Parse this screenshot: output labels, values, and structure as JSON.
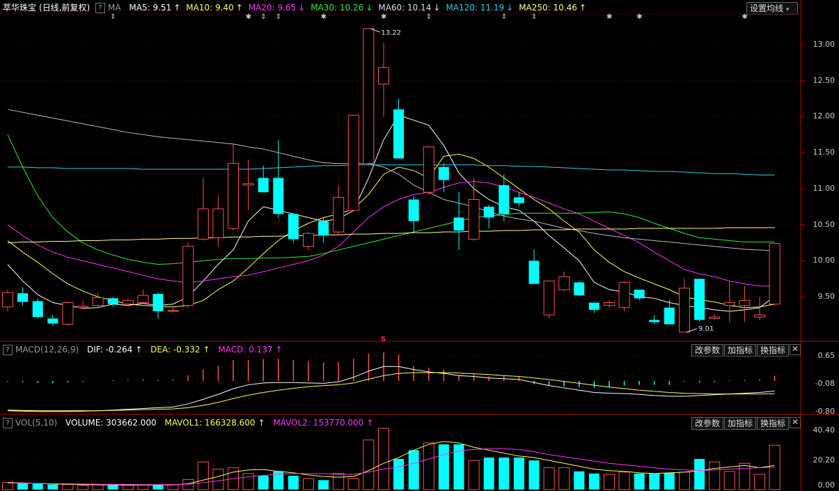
{
  "title": "萃华珠宝",
  "period": "(日线,前复权)",
  "help_label": "?",
  "ma_label": "MA",
  "ma_items": [
    {
      "label": "MA5: 9.51",
      "arrow": "↑",
      "color": "#ffffff"
    },
    {
      "label": "MA10: 9.40",
      "arrow": "↑",
      "color": "#ffff55"
    },
    {
      "label": "MA20: 9.65",
      "arrow": "↓",
      "color": "#ff33ff"
    },
    {
      "label": "MA30: 10.26",
      "arrow": "↓",
      "color": "#33ee33"
    },
    {
      "label": "MA60: 10.14",
      "arrow": "↓",
      "color": "#dddddd"
    },
    {
      "label": "MA120: 11.19",
      "arrow": "↓",
      "color": "#33ccee"
    },
    {
      "label": "MA250: 10.46",
      "arrow": "↑",
      "color": "#ffff88"
    }
  ],
  "settings_button": "设置均线",
  "price_axis": [
    "13.00",
    "12.50",
    "12.00",
    "11.50",
    "11.00",
    "10.50",
    "10.00",
    "9.50"
  ],
  "high_label": "13.22",
  "low_label": "9.01",
  "signal_mark": "S",
  "macd": {
    "label": "MACD(12,26,9)",
    "dif": "DIF: -0.264",
    "dea": "DEA: -0.332",
    "macd": "MACD: 0.137",
    "axis": [
      "0.65",
      "-0.08",
      "-0.80"
    ],
    "btn_params": "改参数",
    "btn_add": "加指标",
    "btn_switch": "换指标",
    "btn_close": "✕"
  },
  "vol": {
    "label": "VOL(5,10)",
    "volume": "VOLUME: 303662.000",
    "mavol1": "MAVOL1: 166328.600",
    "mavol2": "MAVOL2: 153770.000",
    "axis": [
      "40.40",
      "20.20",
      "0.00"
    ],
    "btn_params": "改参数",
    "btn_add": "加指标",
    "btn_switch": "换指标",
    "btn_close": "✕"
  },
  "chart_data": {
    "type": "candlestick",
    "candles": [
      {
        "o": 9.36,
        "c": 9.56,
        "h": 9.6,
        "l": 9.3
      },
      {
        "o": 9.55,
        "c": 9.43,
        "h": 9.63,
        "l": 9.38
      },
      {
        "o": 9.44,
        "c": 9.22,
        "h": 9.48,
        "l": 9.2
      },
      {
        "o": 9.2,
        "c": 9.13,
        "h": 9.25,
        "l": 9.1
      },
      {
        "o": 9.12,
        "c": 9.42,
        "h": 9.44,
        "l": 9.1
      },
      {
        "o": 9.35,
        "c": 9.37,
        "h": 9.45,
        "l": 9.33
      },
      {
        "o": 9.38,
        "c": 9.49,
        "h": 9.55,
        "l": 9.35
      },
      {
        "o": 9.48,
        "c": 9.4,
        "h": 9.5,
        "l": 9.36
      },
      {
        "o": 9.4,
        "c": 9.45,
        "h": 9.48,
        "l": 9.37
      },
      {
        "o": 9.42,
        "c": 9.52,
        "h": 9.6,
        "l": 9.4
      },
      {
        "o": 9.54,
        "c": 9.3,
        "h": 9.56,
        "l": 9.2
      },
      {
        "o": 9.3,
        "c": 9.31,
        "h": 9.35,
        "l": 9.28
      },
      {
        "o": 9.38,
        "c": 10.2,
        "h": 10.25,
        "l": 9.35
      },
      {
        "o": 10.3,
        "c": 10.72,
        "h": 11.15,
        "l": 10.28
      },
      {
        "o": 10.32,
        "c": 10.72,
        "h": 10.9,
        "l": 10.2
      },
      {
        "o": 10.45,
        "c": 11.35,
        "h": 11.62,
        "l": 10.42
      },
      {
        "o": 11.05,
        "c": 11.07,
        "h": 11.4,
        "l": 10.7
      },
      {
        "o": 11.15,
        "c": 10.95,
        "h": 11.32,
        "l": 10.95
      },
      {
        "o": 11.15,
        "c": 10.65,
        "h": 11.68,
        "l": 10.6
      },
      {
        "o": 10.65,
        "c": 10.3,
        "h": 10.65,
        "l": 10.25
      },
      {
        "o": 10.2,
        "c": 10.38,
        "h": 10.4,
        "l": 10.15
      },
      {
        "o": 10.55,
        "c": 10.35,
        "h": 10.6,
        "l": 10.25
      },
      {
        "o": 10.4,
        "c": 10.88,
        "h": 11.05,
        "l": 10.35
      },
      {
        "o": 10.7,
        "c": 12.02,
        "h": 12.02,
        "l": 10.68
      },
      {
        "o": 11.35,
        "c": 13.22,
        "h": 13.22,
        "l": 11.32
      },
      {
        "o": 12.45,
        "c": 12.68,
        "h": 13.02,
        "l": 12.0
      },
      {
        "o": 12.1,
        "c": 11.42,
        "h": 12.25,
        "l": 11.42
      },
      {
        "o": 10.85,
        "c": 10.55,
        "h": 10.9,
        "l": 10.4
      },
      {
        "o": 10.95,
        "c": 11.58,
        "h": 11.6,
        "l": 10.92
      },
      {
        "o": 11.3,
        "c": 11.12,
        "h": 11.35,
        "l": 10.95
      },
      {
        "o": 10.6,
        "c": 10.42,
        "h": 10.95,
        "l": 10.15
      },
      {
        "o": 10.3,
        "c": 10.85,
        "h": 11.15,
        "l": 10.28
      },
      {
        "o": 10.75,
        "c": 10.6,
        "h": 10.78,
        "l": 10.45
      },
      {
        "o": 11.05,
        "c": 10.65,
        "h": 11.2,
        "l": 10.55
      },
      {
        "o": 10.88,
        "c": 10.8,
        "h": 10.95,
        "l": 10.76
      },
      {
        "o": 10.0,
        "c": 9.68,
        "h": 10.16,
        "l": 9.68
      },
      {
        "o": 9.25,
        "c": 9.72,
        "h": 9.72,
        "l": 9.2
      },
      {
        "o": 9.6,
        "c": 9.78,
        "h": 9.85,
        "l": 9.58
      },
      {
        "o": 9.7,
        "c": 9.52,
        "h": 9.72,
        "l": 9.52
      },
      {
        "o": 9.42,
        "c": 9.32,
        "h": 9.42,
        "l": 9.28
      },
      {
        "o": 9.38,
        "c": 9.42,
        "h": 9.45,
        "l": 9.35
      },
      {
        "o": 9.35,
        "c": 9.7,
        "h": 9.72,
        "l": 9.3
      },
      {
        "o": 9.6,
        "c": 9.48,
        "h": 9.6,
        "l": 9.45
      },
      {
        "o": 9.18,
        "c": 9.15,
        "h": 9.25,
        "l": 9.12
      },
      {
        "o": 9.35,
        "c": 9.12,
        "h": 9.46,
        "l": 9.12
      },
      {
        "o": 9.01,
        "c": 9.62,
        "h": 9.75,
        "l": 9.01
      },
      {
        "o": 9.75,
        "c": 9.18,
        "h": 9.75,
        "l": 9.16
      },
      {
        "o": 9.2,
        "c": 9.22,
        "h": 9.26,
        "l": 9.18
      },
      {
        "o": 9.38,
        "c": 9.42,
        "h": 9.72,
        "l": 9.15
      },
      {
        "o": 9.38,
        "c": 9.45,
        "h": 9.65,
        "l": 9.15
      },
      {
        "o": 9.22,
        "c": 9.25,
        "h": 9.5,
        "l": 9.18
      },
      {
        "o": 9.4,
        "c": 10.24,
        "h": 10.24,
        "l": 9.38
      }
    ],
    "ma_lines": {
      "MA5": [
        9.95,
        9.72,
        9.53,
        9.42,
        9.38,
        9.34,
        9.35,
        9.4,
        9.38,
        9.41,
        9.38,
        9.4,
        9.5,
        9.72,
        9.95,
        10.15,
        10.55,
        10.75,
        10.7,
        10.65,
        10.6,
        10.55,
        10.58,
        10.7,
        11.15,
        11.68,
        12.02,
        11.95,
        11.88,
        11.6,
        11.22,
        11.0,
        10.85,
        10.75,
        10.7,
        10.55,
        10.35,
        10.18,
        10.0,
        9.7,
        9.6,
        9.57,
        9.5,
        9.48,
        9.42,
        9.38,
        9.35,
        9.32,
        9.3,
        9.32,
        9.35,
        9.51
      ],
      "MA10": [
        10.28,
        10.12,
        9.98,
        9.82,
        9.68,
        9.58,
        9.5,
        9.45,
        9.4,
        9.38,
        9.37,
        9.36,
        9.38,
        9.45,
        9.6,
        9.72,
        9.9,
        10.1,
        10.28,
        10.42,
        10.52,
        10.6,
        10.65,
        10.72,
        10.92,
        11.2,
        11.3,
        11.25,
        11.15,
        11.45,
        11.48,
        11.42,
        11.3,
        11.15,
        11.0,
        10.85,
        10.72,
        10.55,
        10.4,
        10.15,
        9.98,
        9.85,
        9.76,
        9.68,
        9.6,
        9.5,
        9.46,
        9.43,
        9.38,
        9.35,
        9.36,
        9.4
      ],
      "MA20": [
        10.5,
        10.35,
        10.22,
        10.12,
        10.05,
        10.0,
        9.95,
        9.9,
        9.85,
        9.8,
        9.75,
        9.72,
        9.7,
        9.72,
        9.75,
        9.78,
        9.8,
        9.85,
        9.9,
        9.95,
        10.0,
        10.08,
        10.2,
        10.4,
        10.6,
        10.75,
        10.85,
        10.92,
        10.95,
        11.02,
        11.08,
        11.1,
        11.08,
        11.02,
        10.95,
        10.88,
        10.8,
        10.72,
        10.65,
        10.55,
        10.45,
        10.35,
        10.25,
        10.12,
        10.0,
        9.88,
        9.82,
        9.78,
        9.72,
        9.68,
        9.65,
        9.65
      ],
      "MA30": [
        11.75,
        11.3,
        10.9,
        10.6,
        10.4,
        10.25,
        10.15,
        10.08,
        10.02,
        9.98,
        9.95,
        9.96,
        9.98,
        10.0,
        10.02,
        10.03,
        10.03,
        10.04,
        10.04,
        10.05,
        10.06,
        10.1,
        10.15,
        10.2,
        10.25,
        10.3,
        10.35,
        10.4,
        10.45,
        10.5,
        10.55,
        10.6,
        10.62,
        10.64,
        10.66,
        10.66,
        10.66,
        10.66,
        10.66,
        10.67,
        10.68,
        10.65,
        10.6,
        10.52,
        10.45,
        10.38,
        10.32,
        10.3,
        10.28,
        10.26,
        10.26,
        10.26
      ],
      "MA60": [
        12.1,
        12.06,
        12.02,
        11.98,
        11.94,
        11.9,
        11.86,
        11.82,
        11.78,
        11.75,
        11.72,
        11.7,
        11.68,
        11.66,
        11.64,
        11.62,
        11.58,
        11.55,
        11.5,
        11.45,
        11.4,
        11.36,
        11.35,
        11.35,
        11.35,
        11.3,
        11.2,
        11.05,
        10.95,
        10.85,
        10.8,
        10.75,
        10.68,
        10.62,
        10.58,
        10.55,
        10.5,
        10.45,
        10.42,
        10.38,
        10.35,
        10.32,
        10.3,
        10.28,
        10.26,
        10.24,
        10.22,
        10.2,
        10.18,
        10.16,
        10.15,
        10.14
      ],
      "MA120": [
        11.3,
        11.3,
        11.29,
        11.29,
        11.28,
        11.28,
        11.28,
        11.28,
        11.28,
        11.27,
        11.27,
        11.27,
        11.27,
        11.27,
        11.27,
        11.27,
        11.27,
        11.28,
        11.29,
        11.3,
        11.31,
        11.32,
        11.32,
        11.33,
        11.33,
        11.33,
        11.33,
        11.33,
        11.33,
        11.33,
        11.33,
        11.33,
        11.32,
        11.32,
        11.31,
        11.31,
        11.3,
        11.29,
        11.28,
        11.27,
        11.26,
        11.26,
        11.25,
        11.24,
        11.24,
        11.23,
        11.22,
        11.21,
        11.21,
        11.2,
        11.19,
        11.19
      ],
      "MA250": [
        10.25,
        10.26,
        10.26,
        10.27,
        10.27,
        10.28,
        10.28,
        10.29,
        10.29,
        10.3,
        10.3,
        10.31,
        10.31,
        10.32,
        10.32,
        10.33,
        10.33,
        10.34,
        10.34,
        10.35,
        10.35,
        10.36,
        10.36,
        10.37,
        10.37,
        10.38,
        10.38,
        10.39,
        10.39,
        10.4,
        10.4,
        10.41,
        10.41,
        10.42,
        10.42,
        10.43,
        10.43,
        10.43,
        10.44,
        10.44,
        10.44,
        10.44,
        10.45,
        10.45,
        10.45,
        10.45,
        10.45,
        10.45,
        10.46,
        10.46,
        10.46,
        10.46
      ]
    },
    "macd_hist": [
      -0.02,
      -0.03,
      -0.05,
      -0.06,
      -0.04,
      -0.02,
      0.0,
      0.02,
      0.03,
      0.04,
      0.03,
      0.04,
      0.15,
      0.3,
      0.4,
      0.55,
      0.55,
      0.58,
      0.58,
      0.55,
      0.52,
      0.48,
      0.5,
      0.58,
      0.72,
      0.75,
      0.7,
      0.4,
      0.35,
      0.3,
      0.15,
      0.18,
      0.12,
      0.15,
      0.13,
      -0.08,
      -0.12,
      -0.14,
      -0.16,
      -0.18,
      -0.16,
      -0.12,
      -0.1,
      -0.1,
      -0.1,
      -0.02,
      -0.04,
      -0.03,
      0.02,
      0.03,
      0.04,
      0.137
    ],
    "dif": [
      -0.78,
      -0.79,
      -0.8,
      -0.8,
      -0.8,
      -0.79,
      -0.78,
      -0.76,
      -0.74,
      -0.72,
      -0.7,
      -0.68,
      -0.6,
      -0.48,
      -0.35,
      -0.2,
      -0.1,
      -0.05,
      -0.04,
      -0.04,
      -0.05,
      -0.06,
      -0.02,
      0.1,
      0.26,
      0.38,
      0.38,
      0.3,
      0.24,
      0.2,
      0.14,
      0.12,
      0.08,
      0.06,
      0.04,
      -0.04,
      -0.12,
      -0.18,
      -0.24,
      -0.3,
      -0.32,
      -0.33,
      -0.35,
      -0.38,
      -0.4,
      -0.4,
      -0.38,
      -0.36,
      -0.34,
      -0.32,
      -0.3,
      -0.264
    ],
    "dea": [
      -0.76,
      -0.77,
      -0.78,
      -0.78,
      -0.78,
      -0.78,
      -0.78,
      -0.77,
      -0.76,
      -0.75,
      -0.74,
      -0.73,
      -0.7,
      -0.64,
      -0.56,
      -0.46,
      -0.37,
      -0.3,
      -0.24,
      -0.19,
      -0.15,
      -0.12,
      -0.1,
      -0.05,
      0.05,
      0.14,
      0.2,
      0.22,
      0.22,
      0.22,
      0.21,
      0.19,
      0.17,
      0.14,
      0.12,
      0.08,
      0.04,
      -0.01,
      -0.06,
      -0.11,
      -0.16,
      -0.2,
      -0.24,
      -0.27,
      -0.3,
      -0.32,
      -0.33,
      -0.34,
      -0.34,
      -0.34,
      -0.34,
      -0.332
    ],
    "volume": [
      5,
      4.5,
      4,
      3.5,
      3.5,
      3,
      3.5,
      3,
      3,
      3.2,
      3,
      3.5,
      7,
      19,
      14,
      15,
      11,
      9.5,
      12.5,
      9.5,
      7.5,
      6.5,
      11,
      7.5,
      34,
      42,
      21,
      27,
      32,
      31,
      31,
      20,
      22,
      22,
      22,
      20,
      15,
      15,
      12.5,
      11,
      10.5,
      12,
      11,
      11,
      11.5,
      12,
      21,
      19,
      12.5,
      18,
      10.5,
      30.4
    ],
    "mavol1": [
      4.8,
      4.6,
      4.2,
      3.9,
      3.7,
      3.4,
      3.3,
      3.2,
      3.1,
      3.1,
      3.1,
      3.2,
      4.0,
      6.5,
      9.0,
      12,
      13.5,
      13.8,
      12.5,
      11.5,
      10,
      9,
      8.5,
      9,
      13,
      18,
      22,
      27,
      31,
      33,
      32,
      29,
      27,
      25,
      23,
      22,
      20,
      18,
      16,
      14,
      13,
      12.5,
      11.5,
      11,
      11.5,
      12,
      13,
      14.5,
      15.5,
      16.5,
      15,
      16.6
    ],
    "mavol2": [
      4.5,
      4.4,
      4.3,
      4.1,
      4.0,
      3.8,
      3.7,
      3.6,
      3.5,
      3.4,
      3.4,
      3.4,
      3.7,
      4.8,
      6.0,
      7.5,
      8.8,
      9.8,
      10.5,
      11,
      11,
      11,
      10.5,
      10.5,
      12,
      14,
      15.5,
      18,
      21,
      24,
      26.5,
      27.5,
      28,
      28,
      27.5,
      26,
      24,
      22.5,
      21,
      19.5,
      18,
      17,
      16,
      15,
      14,
      13.5,
      13,
      13.5,
      14,
      14.5,
      15,
      15.4
    ],
    "price_range": [
      9.0,
      13.25
    ],
    "macd_range": [
      -0.82,
      0.75
    ],
    "vol_range": [
      0,
      42
    ]
  }
}
